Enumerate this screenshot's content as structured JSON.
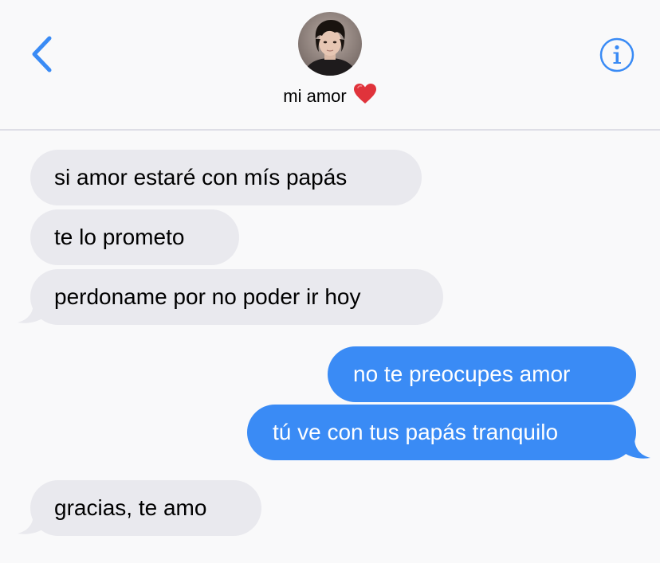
{
  "header": {
    "contact_name": "mi amor",
    "back_icon": "chevron-left-icon",
    "info_icon": "info-icon",
    "avatar_icon": "contact-avatar",
    "heart_icon": "red-heart-emoji",
    "accent_color": "#3a8bf5"
  },
  "messages": [
    {
      "direction": "incoming",
      "text": "si amor estaré con mís papás"
    },
    {
      "direction": "incoming",
      "text": "te lo prometo"
    },
    {
      "direction": "incoming",
      "text": "perdoname por no poder ir hoy"
    },
    {
      "direction": "outgoing",
      "text": "no te preocupes amor"
    },
    {
      "direction": "outgoing",
      "text": "tú ve con tus papás tranquilo"
    },
    {
      "direction": "incoming",
      "text": "gracias, te amo"
    }
  ],
  "colors": {
    "incoming_bubble": "#e9e9ee",
    "outgoing_bubble": "#3a8bf5",
    "background": "#f9f9fa"
  }
}
